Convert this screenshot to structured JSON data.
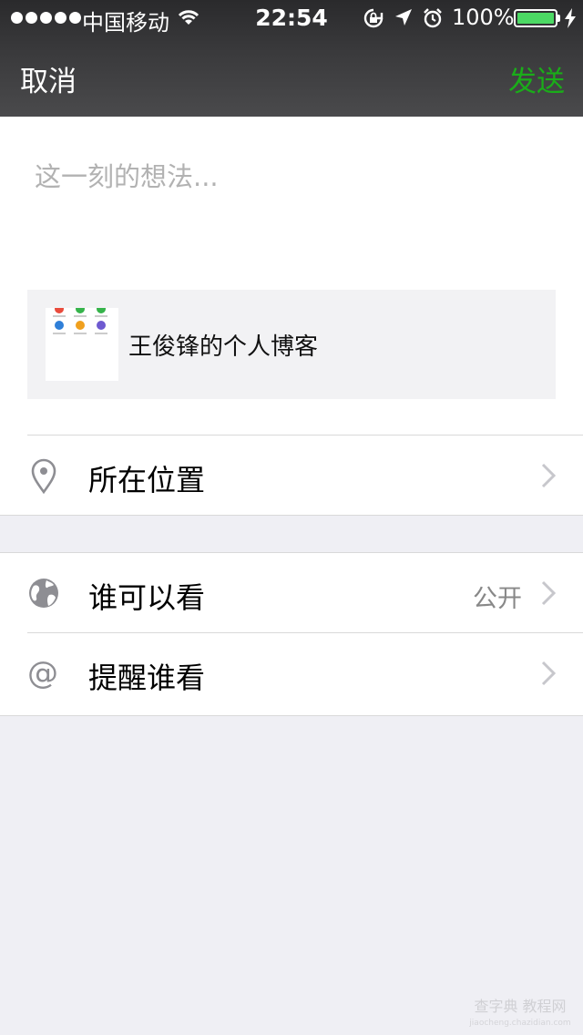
{
  "status_bar": {
    "carrier": "中国移动",
    "time": "22:54",
    "battery_percent": "100%",
    "battery_level": 1.0,
    "icons": [
      "signal-dots-icon",
      "wifi-icon",
      "rotation-lock-icon",
      "location-arrow-icon",
      "alarm-icon",
      "battery-icon",
      "charging-icon"
    ]
  },
  "nav": {
    "cancel_label": "取消",
    "send_label": "发送"
  },
  "compose": {
    "placeholder": "这一刻的想法...",
    "value": ""
  },
  "link_card": {
    "title": "王俊锋的个人博客"
  },
  "rows": {
    "location": {
      "label": "所在位置",
      "icon": "location-pin-icon"
    },
    "visibility": {
      "label": "谁可以看",
      "value": "公开",
      "icon": "globe-icon"
    },
    "mention": {
      "label": "提醒谁看",
      "icon": "at-icon"
    }
  },
  "watermark": {
    "line1": "查字典 教程网",
    "line2": "jiaocheng.chazidian.com"
  },
  "colors": {
    "accent_green": "#1aad19",
    "battery_green": "#4cd964",
    "background": "#efeff4",
    "nav_bg": "#3a3a3c"
  }
}
